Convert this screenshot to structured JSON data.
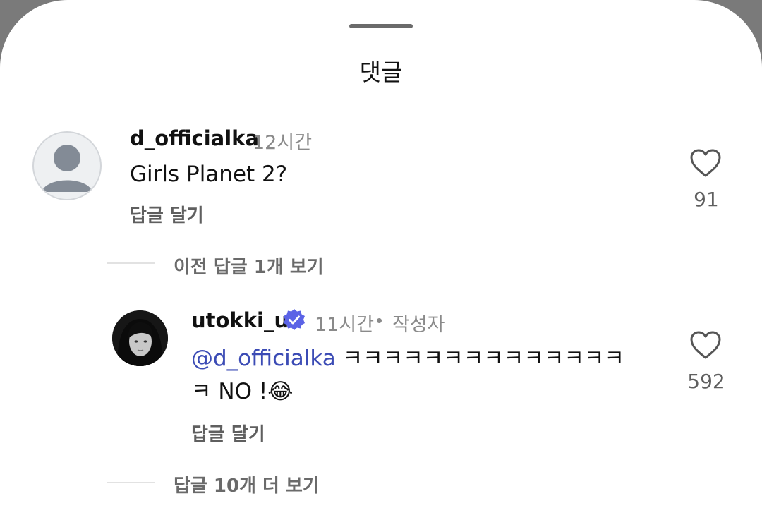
{
  "header": {
    "title": "댓글"
  },
  "comments": [
    {
      "username": "d_officialka",
      "time": "12시간",
      "text": "Girls Planet 2?",
      "reply_label": "답글 달기",
      "likes": "91",
      "avatar_icon": "default-user-icon"
    }
  ],
  "thread": {
    "prev_replies_label": "이전 답글 1개 보기",
    "more_replies_label": "답글 10개 더 보기"
  },
  "reply": {
    "username": "utokki_u",
    "verified_icon": "verified-badge-icon",
    "time": "11시간",
    "author_tag": "작성자",
    "mention": "@d_officialka",
    "text_line1": " ㅋㅋㅋㅋㅋㅋㅋㅋㅋㅋㅋㅋㅋㅋ",
    "text_line2": "ㅋ NO !",
    "emoji": "😂",
    "reply_label": "답글 달기",
    "likes": "592"
  },
  "colors": {
    "accent_mention": "#3b4bb5",
    "verified": "#5b63e6",
    "backdrop": "#7a7a7a"
  }
}
